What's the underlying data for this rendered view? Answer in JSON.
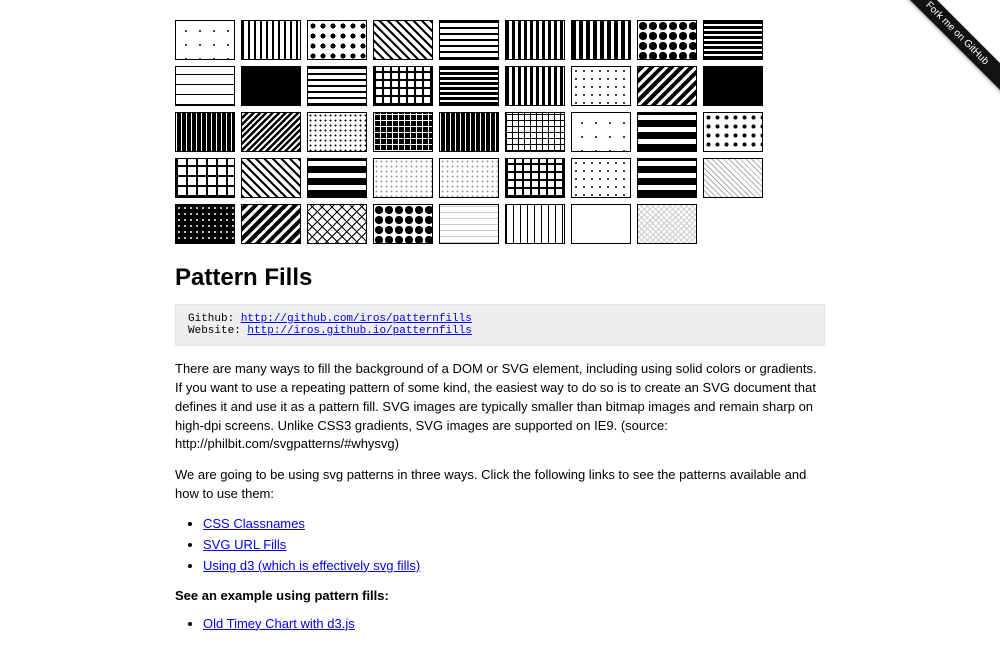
{
  "ribbon": {
    "label": "Fork me on GitHub"
  },
  "title": "Pattern Fills",
  "codebox": {
    "github_label": "Github: ",
    "github_url": "http://github.com/iros/patternfills",
    "website_label": "Website: ",
    "website_url": "http://iros.github.io/patternfills"
  },
  "para1": "There are many ways to fill the background of a DOM or SVG element, including using solid colors or gradients. If you want to use a repeating pattern of some kind, the easiest way to do so is to create an SVG document that defines it and use it as a pattern fill. SVG images are typically smaller than bitmap images and remain sharp on high-dpi screens. Unlike CSS3 gradients, SVG images are supported on IE9. (source: http://philbit.com/svgpatterns/#whysvg)",
  "para2": "We are going to be using svg patterns in three ways. Click the following links to see the patterns available and how to use them:",
  "links": [
    "CSS Classnames",
    "SVG URL Fills",
    "Using d3 (which is effectively svg fills)"
  ],
  "example_heading": "See an example using pattern fills:",
  "example_link": "Old Timey Chart with d3.js"
}
